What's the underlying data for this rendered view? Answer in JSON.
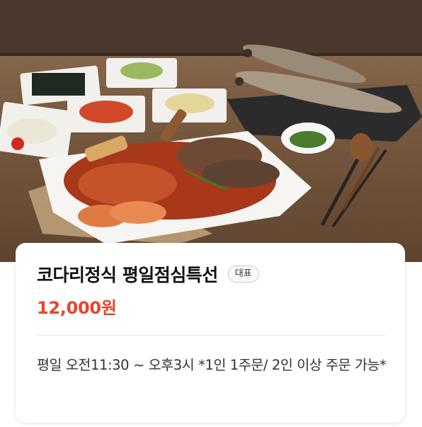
{
  "menu": {
    "title": "코다리정식 평일점심특선",
    "badge": "대표",
    "price": "12,000원",
    "description": "평일 오전11:30 ~ 오후3시 *1인 1주문/ 2인 이상 주문 가능*"
  },
  "photo": {
    "subject": "braised-dried-pollack-dish-with-side-dishes",
    "colors": {
      "wood": "#7a5c42",
      "plate": "#f4f2ee",
      "sauce": "#b5401e"
    }
  }
}
